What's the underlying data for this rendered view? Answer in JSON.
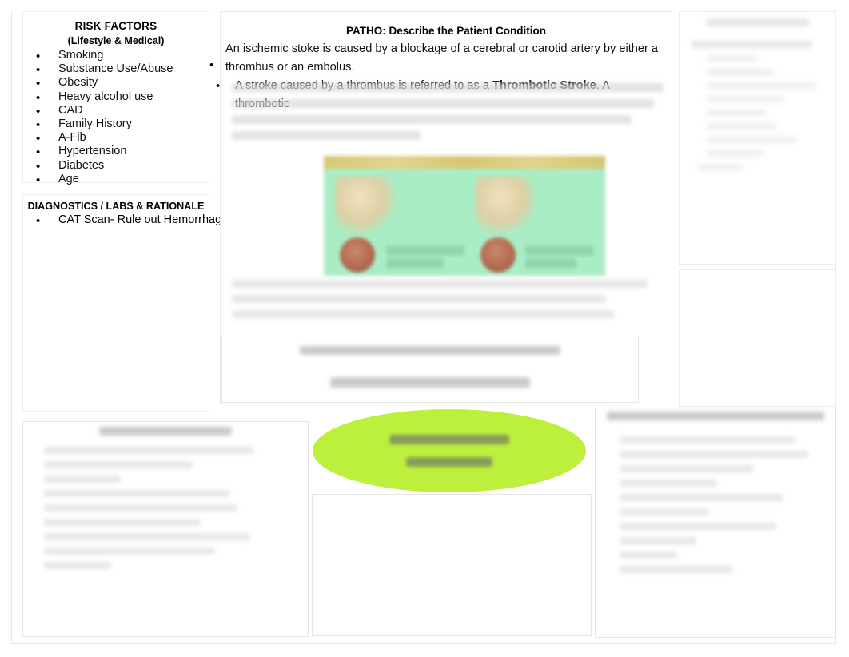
{
  "document": {
    "type": "nursing-concept-map",
    "background_color": "#ffffff"
  },
  "risk_factors": {
    "title": "RISK FACTORS",
    "subtitle": "(Lifestyle & Medical)",
    "bullet_glyph": "•",
    "items": [
      "Smoking",
      "Substance Use/Abuse",
      "Obesity",
      "Heavy alcohol use",
      "CAD",
      "Family History",
      "A-Fib",
      "Hypertension",
      "Diabetes",
      "Age"
    ]
  },
  "diagnostics": {
    "title": "DIAGNOSTICS / LABS & RATIONALE",
    "bullet_glyph": "•",
    "items": [
      "CAT Scan- Rule out Hemorrhagic"
    ]
  },
  "patho": {
    "title": "PATHO:  Describe the Patient Condition",
    "bullet_glyph": "•",
    "paragraph_1": "An ischemic stoke is caused by a blockage of a cerebral or carotid artery by either a thrombus or an embolus.",
    "paragraph_2_part1": "A stroke caused by a thrombus is referred to as a ",
    "paragraph_2_bold": "Thrombotic Stroke",
    "paragraph_2_part2": ".  A thrombotic",
    "figure": {
      "name": "ischemic-stroke-illustration",
      "header_bar_color": "#dccb7e",
      "body_color": "#a9edc5",
      "clot_color": "#b46a4e",
      "legible": false
    },
    "obscured_note": "Remaining body text in this panel is blurred and illegible in the source image."
  },
  "patho_subbox": {
    "legible": false,
    "obscured_note": "Two centred blurred heading lines; text illegible."
  },
  "goal_ellipse": {
    "shape": "ellipse",
    "fill_color": "#bdf03c",
    "legible": false,
    "obscured_note": "Two centred blurred text lines inside the green ellipse; illegible."
  },
  "right_top_panel": {
    "legible": false,
    "obscured_note": "Bordered panel with a blurred centred heading and a blurred bulleted list; illegible."
  },
  "right_mid_panel": {
    "legible": false,
    "obscured_note": "Empty bordered panel."
  },
  "bottom_left_panel": {
    "legible": false,
    "obscured_note": "Bordered panel with a blurred centred heading and a blurred bulleted list; illegible."
  },
  "bottom_centre_box": {
    "legible": false,
    "obscured_note": "Empty bordered box."
  },
  "bottom_right_panel": {
    "legible": false,
    "obscured_note": "Bordered panel with a blurred centred heading and a blurred bulleted list; illegible."
  }
}
